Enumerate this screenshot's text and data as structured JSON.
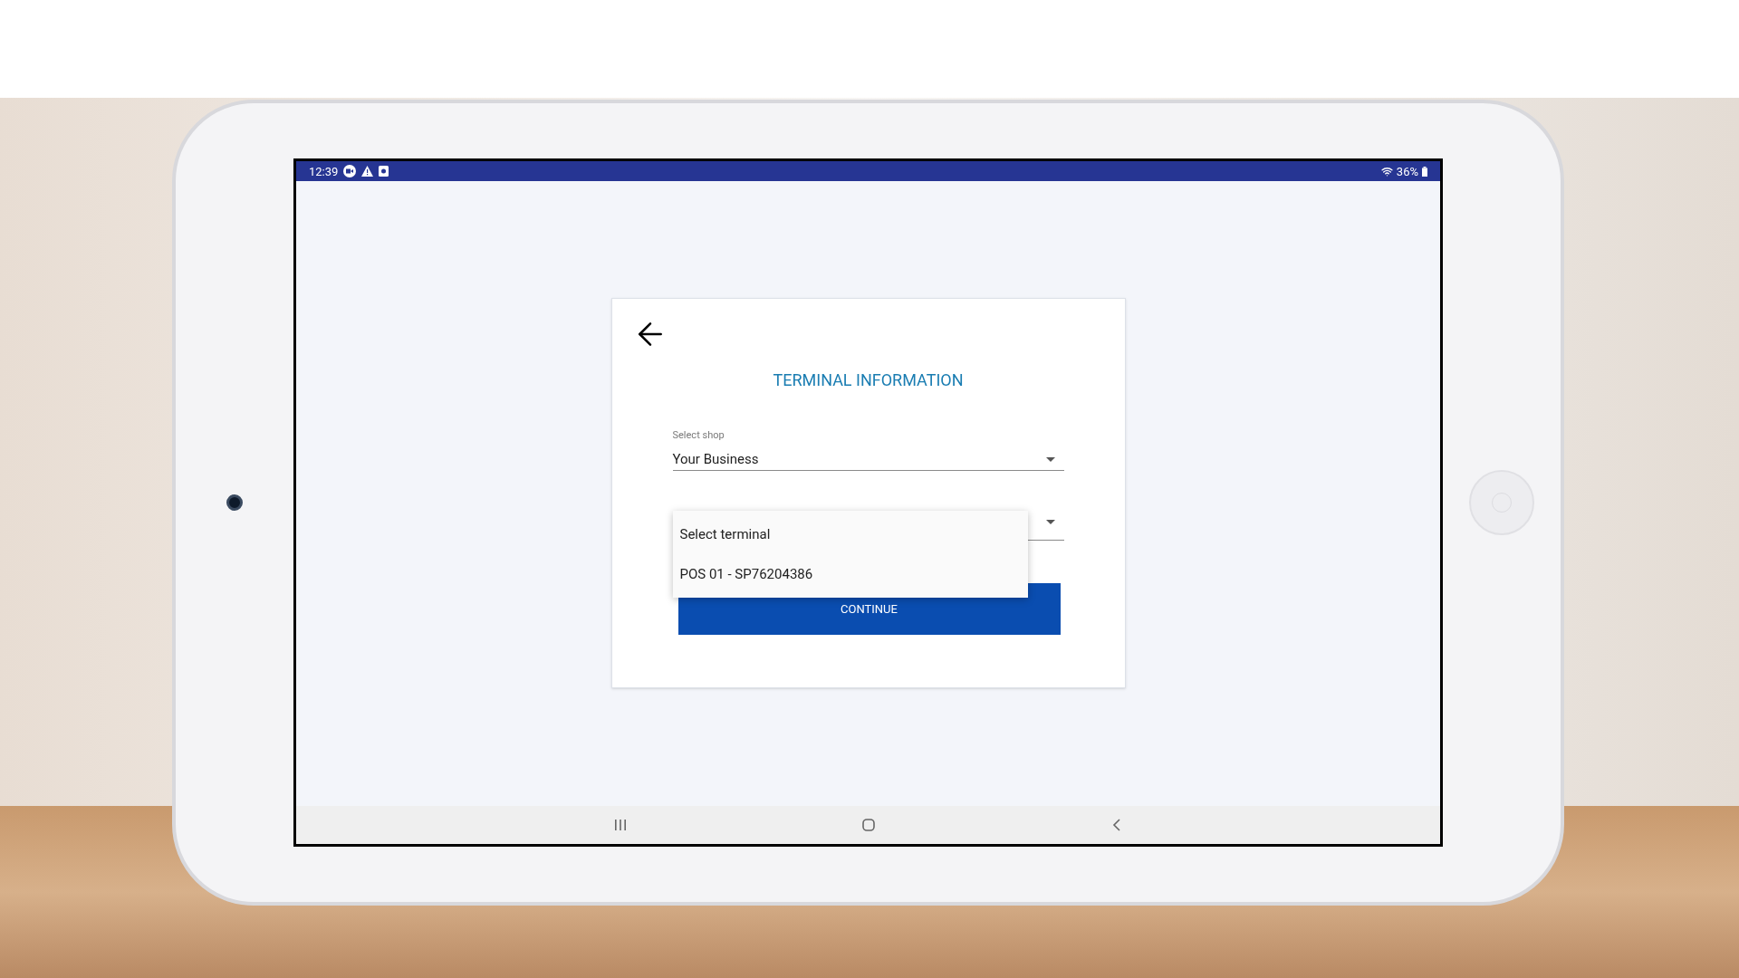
{
  "status_bar": {
    "time": "12:39",
    "battery": "36%"
  },
  "title": "TERMINAL INFORMATION",
  "shop_field": {
    "label": "Select shop",
    "value": "Your Business"
  },
  "terminal_dropdown": {
    "expanded": true,
    "options": [
      {
        "label": "Select terminal",
        "selected": false
      },
      {
        "label": "POS 01 - SP76204386",
        "selected": false
      }
    ]
  },
  "continue_button": "CONTINUE"
}
